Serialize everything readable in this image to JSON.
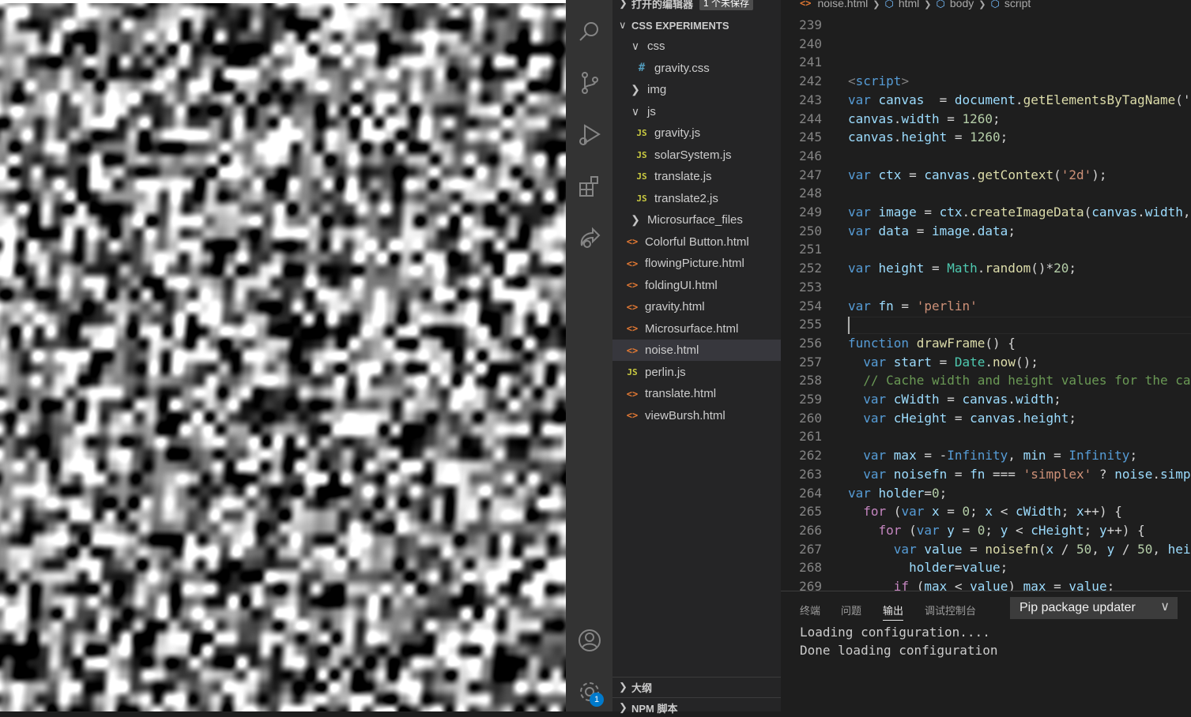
{
  "explorer": {
    "open_editors_label": "打开的编辑器",
    "unsaved_badge": "1 个未保存",
    "folder_label": "CSS EXPERIMENTS",
    "items": [
      {
        "label": "css",
        "kind": "folder",
        "expanded": true,
        "depth": 1
      },
      {
        "label": "gravity.css",
        "kind": "css",
        "depth": 2
      },
      {
        "label": "img",
        "kind": "folder",
        "expanded": false,
        "depth": 1
      },
      {
        "label": "js",
        "kind": "folder",
        "expanded": true,
        "depth": 1
      },
      {
        "label": "gravity.js",
        "kind": "js",
        "depth": 2
      },
      {
        "label": "solarSystem.js",
        "kind": "js",
        "depth": 2
      },
      {
        "label": "translate.js",
        "kind": "js",
        "depth": 2
      },
      {
        "label": "translate2.js",
        "kind": "js",
        "depth": 2
      },
      {
        "label": "Microsurface_files",
        "kind": "folder",
        "expanded": false,
        "depth": 1
      },
      {
        "label": "Colorful Button.html",
        "kind": "html",
        "depth": 1
      },
      {
        "label": "flowingPicture.html",
        "kind": "html",
        "depth": 1
      },
      {
        "label": "foldingUI.html",
        "kind": "html",
        "depth": 1
      },
      {
        "label": "gravity.html",
        "kind": "html",
        "depth": 1
      },
      {
        "label": "Microsurface.html",
        "kind": "html",
        "depth": 1
      },
      {
        "label": "noise.html",
        "kind": "html",
        "depth": 1,
        "selected": true
      },
      {
        "label": "perlin.js",
        "kind": "js",
        "depth": 1
      },
      {
        "label": "translate.html",
        "kind": "html",
        "depth": 1
      },
      {
        "label": "viewBursh.html",
        "kind": "html",
        "depth": 1
      }
    ],
    "outline_label": "大纲",
    "npm_label": "NPM 脚本"
  },
  "activity": {
    "icons": [
      "search-icon",
      "source-control-icon",
      "run-debug-icon",
      "extensions-icon",
      "live-share-icon",
      "account-icon",
      "manage-gear-icon"
    ],
    "settings_badge": "1"
  },
  "breadcrumb": {
    "file": "noise.html",
    "items": [
      "html",
      "body",
      "script"
    ]
  },
  "editor": {
    "first_line": 239,
    "lines": [
      [],
      [],
      [],
      [
        [
          "tag",
          "<"
        ],
        [
          "tagn",
          "script"
        ],
        [
          "tag",
          ">"
        ]
      ],
      [
        [
          "kw",
          "var "
        ],
        [
          "var",
          "canvas"
        ],
        [
          "",
          "  = "
        ],
        [
          "var",
          "document"
        ],
        [
          "",
          "."
        ],
        [
          "fn",
          "getElementsByTagName"
        ],
        [
          "",
          "('c"
        ]
      ],
      [
        [
          "var",
          "canvas"
        ],
        [
          "",
          "."
        ],
        [
          "var",
          "width"
        ],
        [
          "",
          " = "
        ],
        [
          "num",
          "1260"
        ],
        [
          "",
          ";"
        ]
      ],
      [
        [
          "var",
          "canvas"
        ],
        [
          "",
          "."
        ],
        [
          "var",
          "height"
        ],
        [
          "",
          " = "
        ],
        [
          "num",
          "1260"
        ],
        [
          "",
          ";"
        ]
      ],
      [],
      [
        [
          "kw",
          "var "
        ],
        [
          "var",
          "ctx"
        ],
        [
          "",
          " = "
        ],
        [
          "var",
          "canvas"
        ],
        [
          "",
          "."
        ],
        [
          "fn",
          "getContext"
        ],
        [
          "",
          "("
        ],
        [
          "str",
          "'2d'"
        ],
        [
          "",
          ");"
        ]
      ],
      [],
      [
        [
          "kw",
          "var "
        ],
        [
          "var",
          "image"
        ],
        [
          "",
          " = "
        ],
        [
          "var",
          "ctx"
        ],
        [
          "",
          "."
        ],
        [
          "fn",
          "createImageData"
        ],
        [
          "",
          "("
        ],
        [
          "var",
          "canvas"
        ],
        [
          "",
          "."
        ],
        [
          "var",
          "width"
        ],
        [
          "",
          ","
        ]
      ],
      [
        [
          "kw",
          "var "
        ],
        [
          "var",
          "data"
        ],
        [
          "",
          " = "
        ],
        [
          "var",
          "image"
        ],
        [
          "",
          "."
        ],
        [
          "var",
          "data"
        ],
        [
          "",
          ";"
        ]
      ],
      [],
      [
        [
          "kw",
          "var "
        ],
        [
          "var",
          "height"
        ],
        [
          "",
          " = "
        ],
        [
          "cls",
          "Math"
        ],
        [
          "",
          "."
        ],
        [
          "fn",
          "random"
        ],
        [
          "",
          "()*"
        ],
        [
          "num",
          "20"
        ],
        [
          "",
          ";"
        ]
      ],
      [],
      [
        [
          "kw",
          "var "
        ],
        [
          "var",
          "fn"
        ],
        [
          "",
          " = "
        ],
        [
          "str",
          "'perlin'"
        ]
      ],
      [],
      [
        [
          "kw",
          "function "
        ],
        [
          "fn",
          "drawFrame"
        ],
        [
          "",
          "() {"
        ]
      ],
      [
        [
          "",
          "  "
        ],
        [
          "kw",
          "var "
        ],
        [
          "var",
          "start"
        ],
        [
          "",
          " = "
        ],
        [
          "cls",
          "Date"
        ],
        [
          "",
          "."
        ],
        [
          "fn",
          "now"
        ],
        [
          "",
          "();"
        ]
      ],
      [
        [
          "",
          "  "
        ],
        [
          "com",
          "// Cache width and height values for the ca"
        ]
      ],
      [
        [
          "",
          "  "
        ],
        [
          "kw",
          "var "
        ],
        [
          "var",
          "cWidth"
        ],
        [
          "",
          " = "
        ],
        [
          "var",
          "canvas"
        ],
        [
          "",
          "."
        ],
        [
          "var",
          "width"
        ],
        [
          "",
          ";"
        ]
      ],
      [
        [
          "",
          "  "
        ],
        [
          "kw",
          "var "
        ],
        [
          "var",
          "cHeight"
        ],
        [
          "",
          " = "
        ],
        [
          "var",
          "canvas"
        ],
        [
          "",
          "."
        ],
        [
          "var",
          "height"
        ],
        [
          "",
          ";"
        ]
      ],
      [],
      [
        [
          "",
          "  "
        ],
        [
          "kw",
          "var "
        ],
        [
          "var",
          "max"
        ],
        [
          "",
          " = -"
        ],
        [
          "kw",
          "Infinity"
        ],
        [
          "",
          ", "
        ],
        [
          "var",
          "min"
        ],
        [
          "",
          " = "
        ],
        [
          "kw",
          "Infinity"
        ],
        [
          "",
          ";"
        ]
      ],
      [
        [
          "",
          "  "
        ],
        [
          "kw",
          "var "
        ],
        [
          "var",
          "noisefn"
        ],
        [
          "",
          " = "
        ],
        [
          "var",
          "fn"
        ],
        [
          "",
          " === "
        ],
        [
          "str",
          "'simplex'"
        ],
        [
          "",
          " ? "
        ],
        [
          "var",
          "noise"
        ],
        [
          "",
          "."
        ],
        [
          "var",
          "simp"
        ]
      ],
      [
        [
          "kw",
          "var "
        ],
        [
          "var",
          "holder"
        ],
        [
          "",
          "="
        ],
        [
          "num",
          "0"
        ],
        [
          "",
          ";"
        ]
      ],
      [
        [
          "",
          "  "
        ],
        [
          "ctl",
          "for "
        ],
        [
          "",
          "("
        ],
        [
          "kw",
          "var "
        ],
        [
          "var",
          "x"
        ],
        [
          "",
          " = "
        ],
        [
          "num",
          "0"
        ],
        [
          "",
          "; "
        ],
        [
          "var",
          "x"
        ],
        [
          "",
          " < "
        ],
        [
          "var",
          "cWidth"
        ],
        [
          "",
          "; "
        ],
        [
          "var",
          "x"
        ],
        [
          "",
          "++) {"
        ]
      ],
      [
        [
          "",
          "    "
        ],
        [
          "ctl",
          "for "
        ],
        [
          "",
          "("
        ],
        [
          "kw",
          "var "
        ],
        [
          "var",
          "y"
        ],
        [
          "",
          " = "
        ],
        [
          "num",
          "0"
        ],
        [
          "",
          "; "
        ],
        [
          "var",
          "y"
        ],
        [
          "",
          " < "
        ],
        [
          "var",
          "cHeight"
        ],
        [
          "",
          "; "
        ],
        [
          "var",
          "y"
        ],
        [
          "",
          "++) {"
        ]
      ],
      [
        [
          "",
          "      "
        ],
        [
          "kw",
          "var "
        ],
        [
          "var",
          "value"
        ],
        [
          "",
          " = "
        ],
        [
          "fn",
          "noisefn"
        ],
        [
          "",
          "("
        ],
        [
          "var",
          "x"
        ],
        [
          "",
          " / "
        ],
        [
          "num",
          "50"
        ],
        [
          "",
          ", "
        ],
        [
          "var",
          "y"
        ],
        [
          "",
          " / "
        ],
        [
          "num",
          "50"
        ],
        [
          "",
          ", "
        ],
        [
          "var",
          "hei"
        ]
      ],
      [
        [
          "",
          "        "
        ],
        [
          "var",
          "holder"
        ],
        [
          "",
          "="
        ],
        [
          "var",
          "value"
        ],
        [
          "",
          ";"
        ]
      ],
      [
        [
          "",
          "      "
        ],
        [
          "ctl",
          "if "
        ],
        [
          "",
          "("
        ],
        [
          "var",
          "max"
        ],
        [
          "",
          " < "
        ],
        [
          "var",
          "value"
        ],
        [
          "",
          ") "
        ],
        [
          "var",
          "max"
        ],
        [
          "",
          " = "
        ],
        [
          "var",
          "value"
        ],
        [
          "",
          ";"
        ]
      ]
    ]
  },
  "panel": {
    "tabs": [
      {
        "label": "终端",
        "active": false
      },
      {
        "label": "问题",
        "active": false
      },
      {
        "label": "输出",
        "active": true
      },
      {
        "label": "调试控制台",
        "active": false
      }
    ],
    "channel": "Pip package updater",
    "output": [
      "Loading configuration....",
      "Done loading configuration"
    ]
  },
  "colors": {
    "activity_bar": "#333333",
    "sidebar": "#252526",
    "editor_bg": "#1e1e1e",
    "accent": "#007acc"
  }
}
